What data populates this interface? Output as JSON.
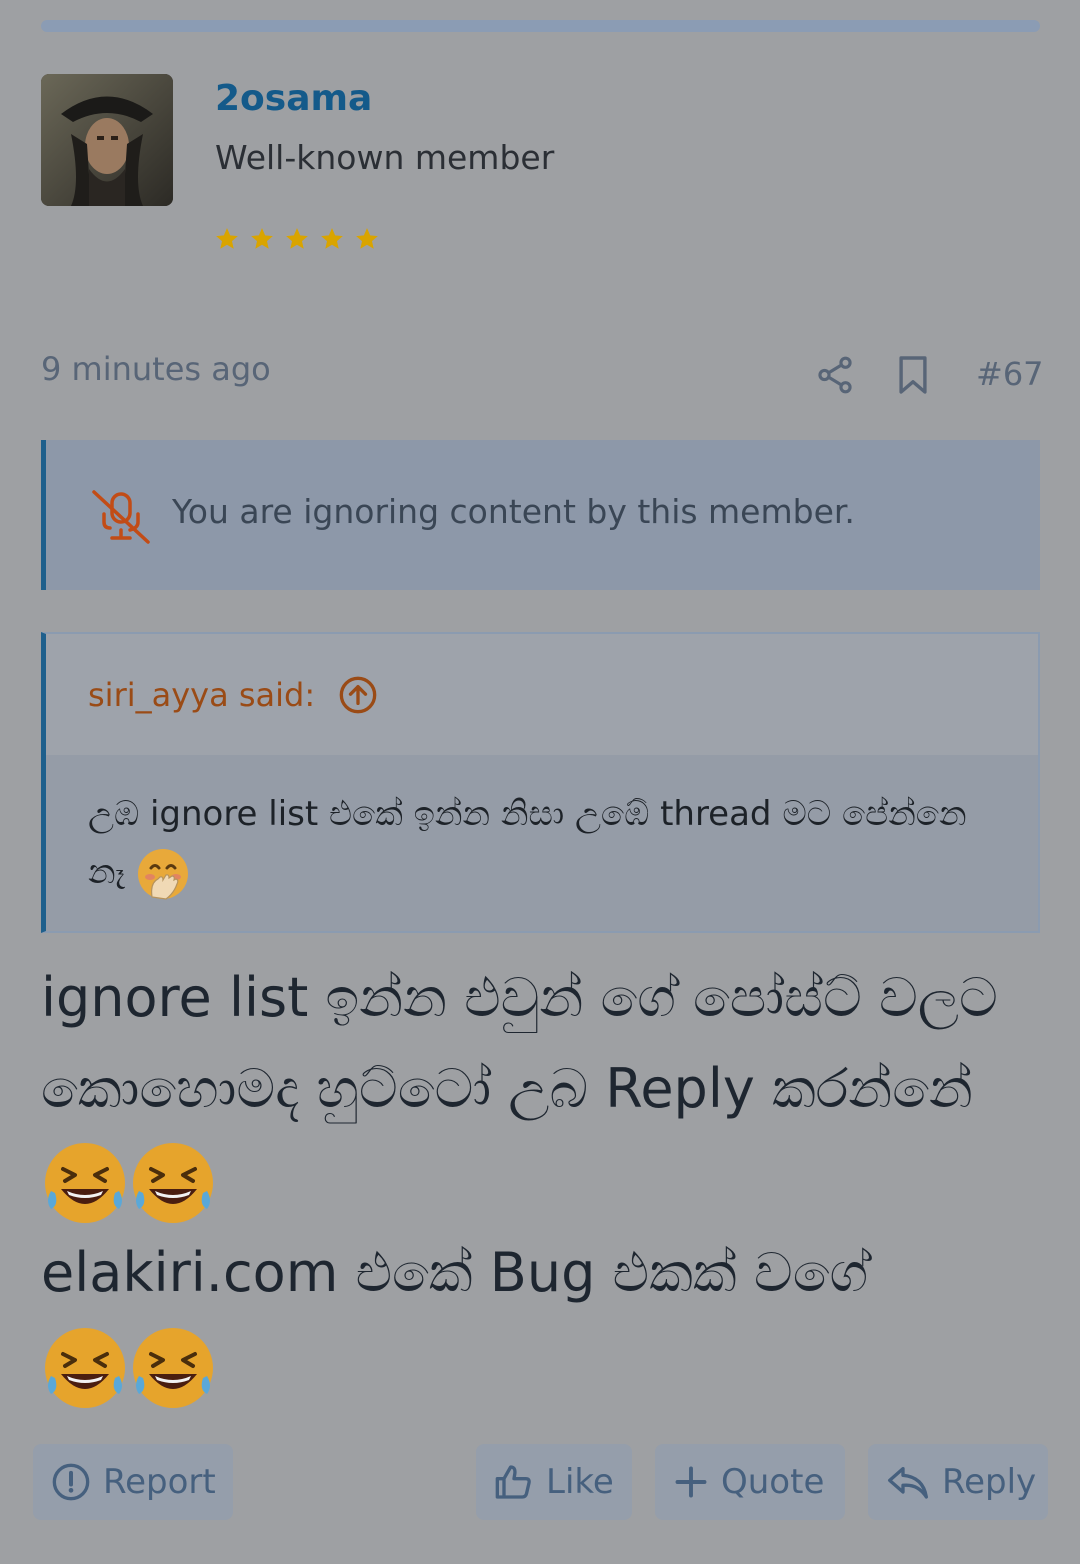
{
  "post": {
    "username": "2osama",
    "user_title": "Well-known member",
    "star_rating": 5,
    "time": "9 minutes ago",
    "post_number": "#67"
  },
  "ignore_notice": {
    "text": "You are ignoring content by this member."
  },
  "quote": {
    "author": "siri_ayya said:",
    "text": "උඹ ignore list එකේ ඉන්න නිසා උඹේ thread මට පේන්නෙ නෑ"
  },
  "message": {
    "line1": "ignore list ඉන්න එවුන් ගේ පෝස්ට් වලට කොහොමද හුට්ටෝ උබ Reply කරන්නේ",
    "line2": "elakiri.com එකේ Bug එකක් වගේ"
  },
  "actions": {
    "report": "Report",
    "like": "Like",
    "quote": "Quote",
    "reply": "Reply"
  },
  "colors": {
    "username": "#145a8a",
    "quote_author": "#9a4b16",
    "star": "#d9a400",
    "accent_border": "#1e5f8c"
  },
  "icons": [
    "share-icon",
    "bookmark-icon",
    "ignore-icon",
    "arrow-up-circle-icon",
    "thumb-up-icon",
    "plus-icon",
    "reply-arrow-icon",
    "report-icon",
    "laughing-emoji",
    "face-with-hand-emoji"
  ]
}
